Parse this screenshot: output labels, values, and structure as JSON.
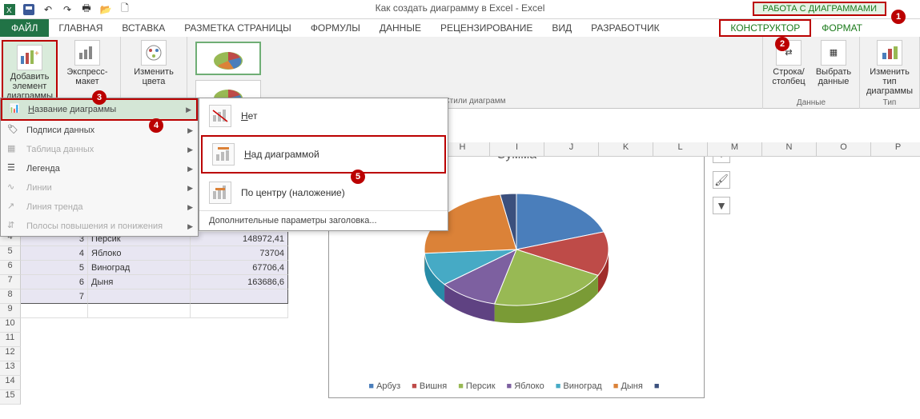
{
  "app": {
    "window_title": "Как создать диаграмму в Excel - Excel",
    "chart_tools_label": "РАБОТА С ДИАГРАММАМИ"
  },
  "tabs": {
    "file": "ФАЙЛ",
    "home": "ГЛАВНАЯ",
    "insert": "ВСТАВКА",
    "page_layout": "РАЗМЕТКА СТРАНИЦЫ",
    "formulas": "ФОРМУЛЫ",
    "data": "ДАННЫЕ",
    "review": "РЕЦЕНЗИРОВАНИЕ",
    "view": "ВИД",
    "developer": "РАЗРАБОТЧИК",
    "design": "КОНСТРУКТОР",
    "format": "ФОРМАТ"
  },
  "ribbon": {
    "add_element": "Добавить элемент диаграммы",
    "express_layout": "Экспресс-макет",
    "change_colors": "Изменить цвета",
    "styles_label": "Стили диаграмм",
    "row_col": "Строка/ столбец",
    "select_data": "Выбрать данные",
    "data_label": "Данные",
    "change_type": "Изменить тип диаграммы",
    "type_label": "Тип"
  },
  "menu1": {
    "chart_title": "Название диаграммы",
    "data_labels": "Подписи данных",
    "data_table": "Таблица данных",
    "legend": "Легенда",
    "lines": "Линии",
    "trendline": "Линия тренда",
    "up_down_bars": "Полосы повышения и понижения"
  },
  "menu2": {
    "none": "Нет",
    "above": "Над диаграммой",
    "centered": "По центру (наложение)",
    "more": "Дополнительные параметры заголовка..."
  },
  "columns": [
    "H",
    "I",
    "J",
    "K",
    "L",
    "M",
    "N",
    "O",
    "P"
  ],
  "row_numbers": [
    "4",
    "5",
    "6",
    "7",
    "8",
    "9",
    "10",
    "11",
    "12",
    "13",
    "14",
    "15"
  ],
  "table": {
    "rows": [
      {
        "n": "3",
        "name": "Персик",
        "val": "148972,41"
      },
      {
        "n": "4",
        "name": "Яблоко",
        "val": "73704"
      },
      {
        "n": "5",
        "name": "Виноград",
        "val": "67706,4"
      },
      {
        "n": "6",
        "name": "Дыня",
        "val": "163686,6"
      },
      {
        "n": "7",
        "name": "",
        "val": ""
      }
    ]
  },
  "chart_data": {
    "type": "pie",
    "title": "Сумма",
    "series": [
      {
        "name": "Арбуз",
        "value": 140000,
        "color": "#4a7ebb"
      },
      {
        "name": "Вишня",
        "value": 90000,
        "color": "#be4b48"
      },
      {
        "name": "Персик",
        "value": 148972.41,
        "color": "#98b954"
      },
      {
        "name": "Яблоко",
        "value": 73704,
        "color": "#7d60a0"
      },
      {
        "name": "Виноград",
        "value": 67706.4,
        "color": "#46aac5"
      },
      {
        "name": "Дыня",
        "value": 163686.6,
        "color": "#db8238"
      },
      {
        "name": "",
        "value": 20000,
        "color": "#3b507d"
      }
    ]
  },
  "callouts": {
    "1": "1",
    "2": "2",
    "3": "3",
    "4": "4",
    "5": "5"
  }
}
